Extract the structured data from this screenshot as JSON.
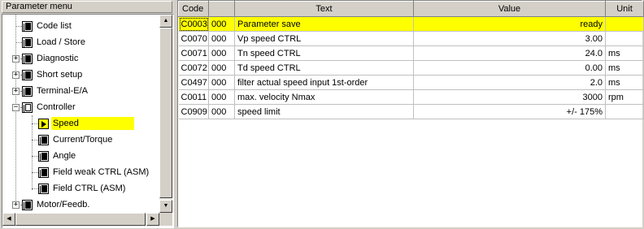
{
  "left_panel": {
    "title": "Parameter menu",
    "tree": [
      {
        "label": "Code list",
        "expander": "",
        "icon": "book-icon"
      },
      {
        "label": "Load / Store",
        "expander": "",
        "icon": "book-icon"
      },
      {
        "label": "Diagnostic",
        "expander": "+",
        "icon": "book-icon"
      },
      {
        "label": "Short setup",
        "expander": "+",
        "icon": "book-icon"
      },
      {
        "label": "Terminal-E/A",
        "expander": "+",
        "icon": "book-icon"
      },
      {
        "label": "Controller",
        "expander": "−",
        "icon": "book-open-icon"
      },
      {
        "label": "Speed",
        "expander": "",
        "icon": "arrow-right-icon",
        "selected": true
      },
      {
        "label": "Current/Torque",
        "expander": "",
        "icon": "book-icon"
      },
      {
        "label": "Angle",
        "expander": "",
        "icon": "book-icon"
      },
      {
        "label": "Field weak CTRL (ASM)",
        "expander": "",
        "icon": "book-icon"
      },
      {
        "label": "Field CTRL (ASM)",
        "expander": "",
        "icon": "book-icon"
      },
      {
        "label": "Motor/Feedb.",
        "expander": "+",
        "icon": "book-icon"
      }
    ]
  },
  "table": {
    "columns": [
      "Code",
      "",
      "Text",
      "Value",
      "Unit"
    ],
    "rows": [
      {
        "code": "C0003",
        "sub": "000",
        "text": "Parameter save",
        "value": "ready",
        "unit": ""
      },
      {
        "code": "C0070",
        "sub": "000",
        "text": "Vp speed CTRL",
        "value": "3.00",
        "unit": ""
      },
      {
        "code": "C0071",
        "sub": "000",
        "text": "Tn speed CTRL",
        "value": "24.0",
        "unit": "ms"
      },
      {
        "code": "C0072",
        "sub": "000",
        "text": "Td speed CTRL",
        "value": "0.00",
        "unit": "ms"
      },
      {
        "code": "C0497",
        "sub": "000",
        "text": "filter actual speed input 1st-order",
        "value": "2.0",
        "unit": "ms"
      },
      {
        "code": "C0011",
        "sub": "000",
        "text": "max. velocity Nmax",
        "value": "3000",
        "unit": "rpm"
      },
      {
        "code": "C0909",
        "sub": "000",
        "text": "speed limit",
        "value": "+/- 175%",
        "unit": ""
      }
    ]
  },
  "colors": {
    "highlight": "#ffff00",
    "chrome": "#d4d0c8"
  }
}
